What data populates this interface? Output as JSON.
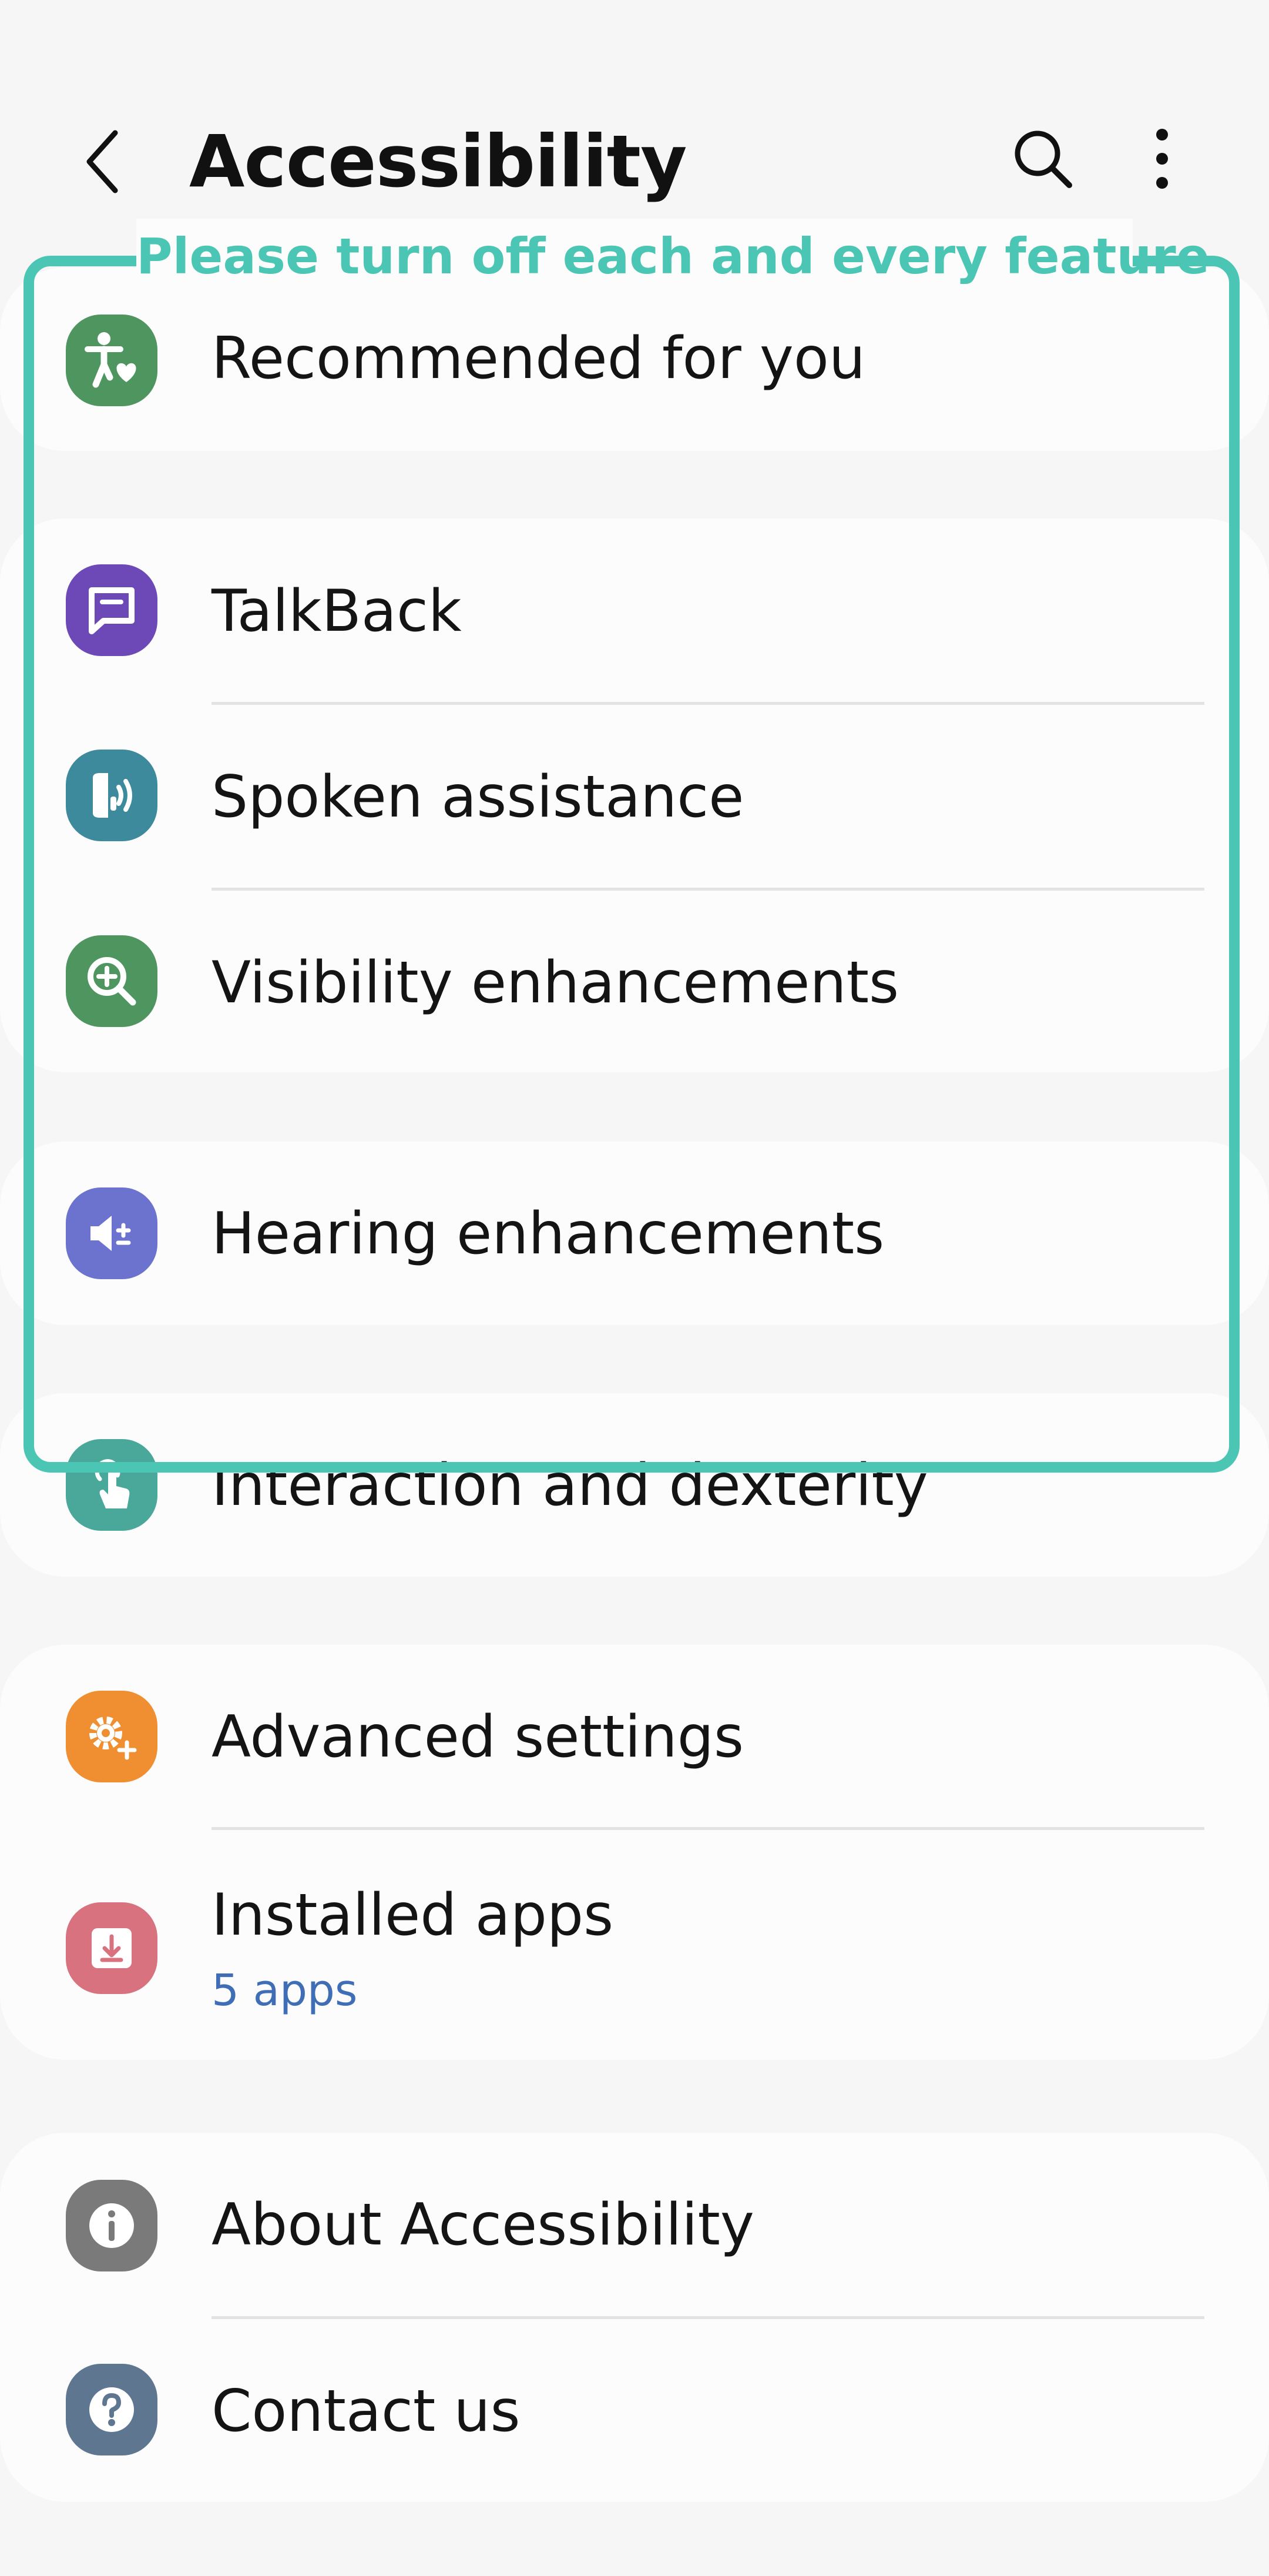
{
  "header": {
    "title": "Accessibility"
  },
  "overlay": {
    "note": "Please turn off each and every feature",
    "color": "#4cc6b4"
  },
  "items": {
    "recommended": {
      "label": "Recommended for you",
      "icon": "accessibility-person-icon",
      "color": "#4e9560"
    },
    "talkback": {
      "label": "TalkBack",
      "icon": "chat-bubble-icon",
      "color": "#6c49b6"
    },
    "spoken": {
      "label": "Spoken assistance",
      "icon": "speaker-sound-icon",
      "color": "#3d8a9c"
    },
    "visibility": {
      "label": "Visibility enhancements",
      "icon": "magnifier-plus-icon",
      "color": "#4e9560"
    },
    "hearing": {
      "label": "Hearing enhancements",
      "icon": "volume-plus-minus-icon",
      "color": "#6b73cf"
    },
    "interaction": {
      "label": "Interaction and dexterity",
      "icon": "touch-hand-icon",
      "color": "#4aa89b"
    },
    "advanced": {
      "label": "Advanced settings",
      "icon": "gear-plus-icon",
      "color": "#ef8f32"
    },
    "installed": {
      "label": "Installed apps",
      "sub": "5 apps",
      "icon": "download-tray-icon",
      "color": "#d8727f"
    },
    "about": {
      "label": "About Accessibility",
      "icon": "info-icon",
      "color": "#7a7a7a"
    },
    "contact": {
      "label": "Contact us",
      "icon": "question-icon",
      "color": "#5f7691"
    }
  }
}
